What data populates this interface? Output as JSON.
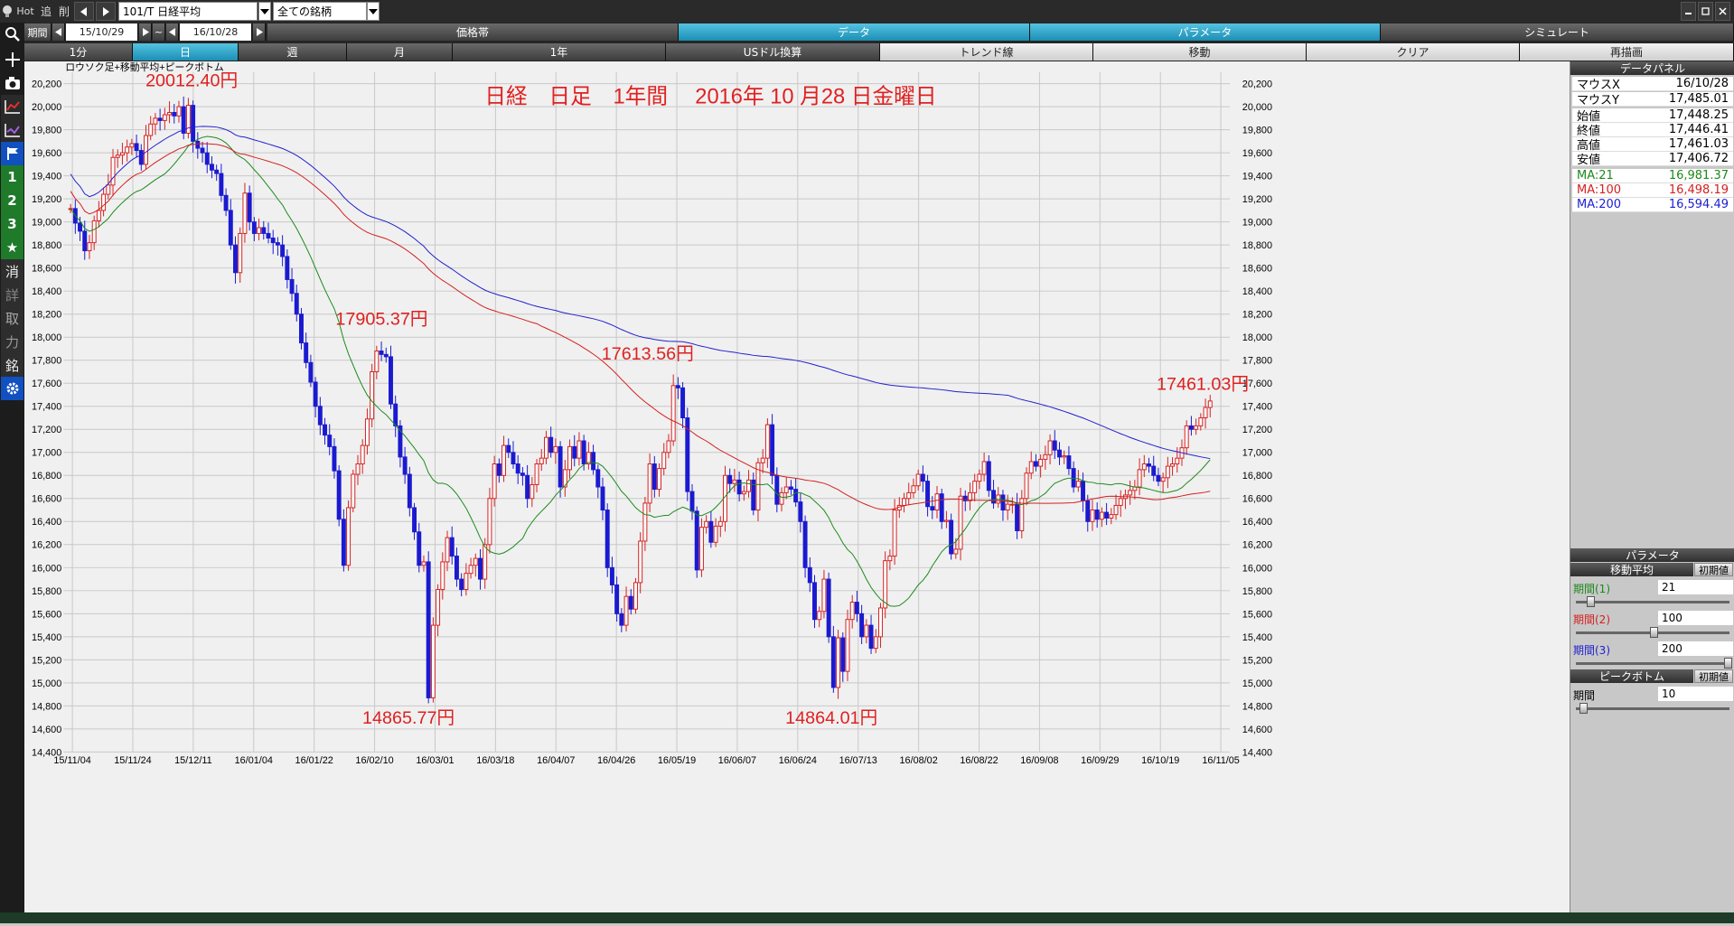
{
  "toolbar": {
    "hot": "Hot",
    "add": "追",
    "del": "削",
    "symbol": "101/T 日経平均",
    "scope": "全ての銘柄",
    "period_label": "期間",
    "from": "15/10/29",
    "tilde": "~",
    "to": "16/10/28"
  },
  "tabs_row2": [
    "価格帯",
    "データ",
    "パラメータ",
    "シミュレート"
  ],
  "tabs_row3": [
    "1分",
    "日",
    "週",
    "月",
    "1年",
    "USドル換算",
    "トレンド線",
    "移動",
    "クリア",
    "再描画"
  ],
  "left_tools": [
    "search-icon",
    "crosshair-icon",
    "camera-icon",
    "chart-red-icon",
    "chart-purple-icon",
    "flag-icon",
    "1",
    "2",
    "3",
    "★",
    "消",
    "詳",
    "取",
    "力",
    "銘",
    "gear-icon"
  ],
  "left_tool_labels": {
    "b1": "1",
    "b2": "2",
    "b3": "3",
    "star": "★",
    "k1": "消",
    "k2": "詳",
    "k3": "取",
    "k4": "力",
    "k5": "銘"
  },
  "chart_header": "ロウソク足+移動平均+ピークボトム",
  "chart_title": "日経　日足　1年間　 2016年 10 月28  日金曜日",
  "big_labels": {
    "a": "20012.40円",
    "b": "17905.37円",
    "c": "17613.56円",
    "d": "17461.03円",
    "e": "14865.77円",
    "f": "14864.01円"
  },
  "panel": {
    "data_title": "データパネル",
    "rows": [
      {
        "k": "マウスX",
        "v": "16/10/28"
      },
      {
        "k": "マウスY",
        "v": "17,485.01"
      },
      {
        "k": "始値",
        "v": "17,448.25"
      },
      {
        "k": "終値",
        "v": "17,446.41"
      },
      {
        "k": "高値",
        "v": "17,461.03"
      },
      {
        "k": "安値",
        "v": "17,406.72"
      },
      {
        "k": "MA:21",
        "v": "16,981.37"
      },
      {
        "k": "MA:100",
        "v": "16,498.19"
      },
      {
        "k": "MA:200",
        "v": "16,594.49"
      }
    ],
    "param_title": "パラメータ",
    "ma_title": "移動平均",
    "init": "初期値",
    "p1": "期間(1)",
    "v1": "21",
    "p2": "期間(2)",
    "v2": "100",
    "p3": "期間(3)",
    "v3": "200",
    "pb_title": "ピークボトム",
    "pb_period": "期間",
    "pb_val": "10",
    "colors": {
      "ma21": "#1a8a1a",
      "ma100": "#d42020",
      "ma200": "#2020d0"
    }
  },
  "chart_data": {
    "type": "line",
    "title": "日経　日足　1年間　 2016年 10 月28  日金曜日",
    "ylim": [
      14400,
      20300
    ],
    "yticks": [
      20200,
      20000,
      19800,
      19600,
      19400,
      19200,
      19000,
      18800,
      18600,
      18400,
      18200,
      18000,
      17800,
      17600,
      17400,
      17200,
      17000,
      16800,
      16600,
      16400,
      16200,
      16000,
      15800,
      15600,
      15400,
      15200,
      15000,
      14800,
      14600,
      14400
    ],
    "ytick_labels": [
      "20,200",
      "20,000",
      "19,800",
      "19,600",
      "19,400",
      "19,200",
      "19,000",
      "18,800",
      "18,600",
      "18,400",
      "18,200",
      "18,000",
      "17,800",
      "17,600",
      "17,400",
      "17,200",
      "17,000",
      "16,800",
      "16,600",
      "16,400",
      "16,200",
      "16,000",
      "15,800",
      "15,600",
      "15,400",
      "15,200",
      "15,000",
      "14,800",
      "14,600",
      "14,400"
    ],
    "xlabels": [
      "15/11/04",
      "15/11/24",
      "15/12/11",
      "16/01/04",
      "16/01/22",
      "16/02/10",
      "16/03/01",
      "16/03/18",
      "16/04/07",
      "16/04/26",
      "16/05/19",
      "16/06/07",
      "16/06/24",
      "16/07/13",
      "16/08/02",
      "16/08/22",
      "16/09/08",
      "16/09/29",
      "16/10/19",
      "16/11/05"
    ],
    "close": [
      19116,
      18990,
      18920,
      18750,
      18820,
      19010,
      19100,
      19240,
      19320,
      19560,
      19580,
      19600,
      19650,
      19680,
      19620,
      19500,
      19750,
      19850,
      19900,
      19880,
      19930,
      19950,
      19920,
      20000,
      19770,
      20012,
      19700,
      19640,
      19600,
      19500,
      19450,
      19420,
      19230,
      19100,
      18800,
      18560,
      18900,
      19250,
      19000,
      18900,
      18950,
      18900,
      18860,
      18820,
      18800,
      18700,
      18500,
      18380,
      18200,
      17950,
      17780,
      17610,
      17400,
      17240,
      17150,
      17050,
      16840,
      16420,
      16020,
      16520,
      16810,
      16900,
      17060,
      17290,
      17700,
      17880,
      17850,
      17830,
      17420,
      17230,
      16960,
      16810,
      16520,
      16310,
      16020,
      16050,
      14870,
      15500,
      15810,
      16050,
      16260,
      16100,
      15900,
      15810,
      15950,
      16020,
      16080,
      15900,
      16200,
      16600,
      16900,
      16800,
      17060,
      17000,
      16900,
      16820,
      16800,
      16600,
      16720,
      16900,
      16950,
      17130,
      17000,
      17050,
      16700,
      16850,
      17050,
      16950,
      17100,
      16900,
      17000,
      16850,
      16700,
      16500,
      16000,
      15850,
      15600,
      15500,
      15750,
      15640,
      15870,
      16230,
      16560,
      16900,
      16680,
      16860,
      17000,
      17100,
      17580,
      17560,
      17300,
      16660,
      16490,
      15980,
      16350,
      16400,
      16220,
      16360,
      16400,
      16800,
      16730,
      16760,
      16640,
      16660,
      16760,
      16500,
      16910,
      16950,
      17240,
      16800,
      16550,
      16650,
      16700,
      16680,
      16570,
      16400,
      16000,
      15870,
      15550,
      15620,
      15900,
      15400,
      14960,
      15390,
      15100,
      15550,
      15700,
      15600,
      15400,
      15500,
      15300,
      15400,
      15650,
      16060,
      16100,
      16500,
      16540,
      16600,
      16650,
      16710,
      16810,
      16750,
      16530,
      16500,
      16640,
      16400,
      16410,
      16120,
      16160,
      16620,
      16580,
      16650,
      16750,
      16810,
      16920,
      16670,
      16560,
      16630,
      16500,
      16550,
      16550,
      16320,
      16600,
      16820,
      16920,
      16880,
      16940,
      16980,
      17100,
      17020,
      16960,
      16970,
      16860,
      16700,
      16750,
      16580,
      16400,
      16500,
      16420,
      16480,
      16430,
      16460,
      16540,
      16600,
      16630,
      16670,
      16700,
      16850,
      16900,
      16880,
      16800,
      16750,
      16780,
      16880,
      16900,
      16950,
      17040,
      17230,
      17200,
      17230,
      17300,
      17390,
      17446
    ]
  }
}
